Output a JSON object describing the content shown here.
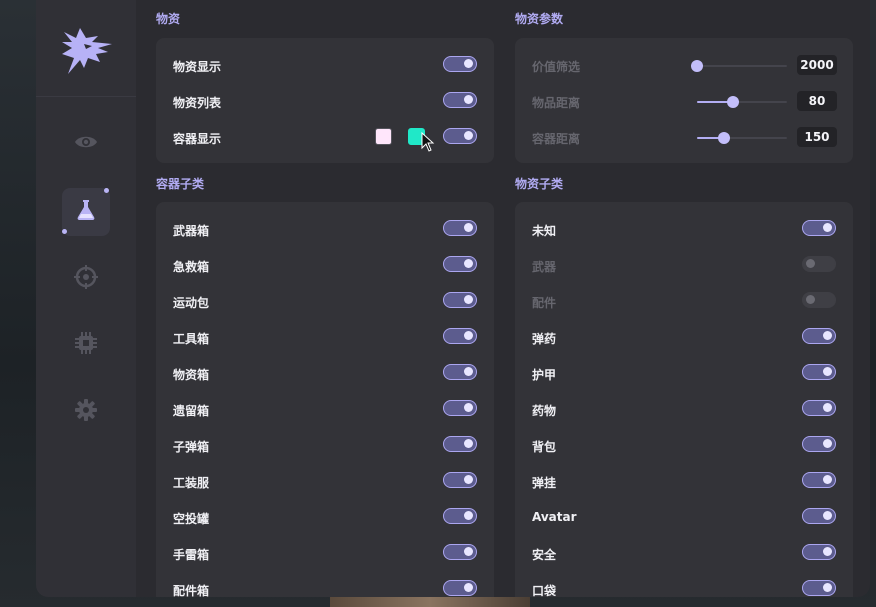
{
  "sections": {
    "items": {
      "title": "物资"
    },
    "item_params": {
      "title": "物资参数"
    },
    "container_types": {
      "title": "容器子类"
    },
    "item_types": {
      "title": "物资子类"
    }
  },
  "items_panel": {
    "rows": [
      {
        "label": "物资显示",
        "enabled": true
      },
      {
        "label": "物资列表",
        "enabled": true
      },
      {
        "label": "容器显示",
        "enabled": true
      }
    ],
    "container_colors": [
      "#ffe6fb",
      "#20e8c8"
    ]
  },
  "params_panel": {
    "rows": [
      {
        "label": "价值筛选",
        "value": "2000",
        "level": 0.0
      },
      {
        "label": "物品距离",
        "value": "80",
        "level": 0.4
      },
      {
        "label": "容器距离",
        "value": "150",
        "level": 0.3
      }
    ]
  },
  "container_types": [
    {
      "label": "武器箱",
      "enabled": true
    },
    {
      "label": "急救箱",
      "enabled": true
    },
    {
      "label": "运动包",
      "enabled": true
    },
    {
      "label": "工具箱",
      "enabled": true
    },
    {
      "label": "物资箱",
      "enabled": true
    },
    {
      "label": "遗留箱",
      "enabled": true
    },
    {
      "label": "子弹箱",
      "enabled": true
    },
    {
      "label": "工装服",
      "enabled": true
    },
    {
      "label": "空投罐",
      "enabled": true
    },
    {
      "label": "手雷箱",
      "enabled": true
    },
    {
      "label": "配件箱",
      "enabled": true
    }
  ],
  "item_types": [
    {
      "label": "未知",
      "enabled": true
    },
    {
      "label": "武器",
      "enabled": false
    },
    {
      "label": "配件",
      "enabled": false
    },
    {
      "label": "弹药",
      "enabled": true
    },
    {
      "label": "护甲",
      "enabled": true
    },
    {
      "label": "药物",
      "enabled": true
    },
    {
      "label": "背包",
      "enabled": true
    },
    {
      "label": "弹挂",
      "enabled": true
    },
    {
      "label": "Avatar",
      "enabled": true
    },
    {
      "label": "安全",
      "enabled": true
    },
    {
      "label": "口袋",
      "enabled": true
    }
  ],
  "sidebar": {
    "items": [
      {
        "icon": "eye-icon",
        "active": false
      },
      {
        "icon": "flask-icon",
        "active": true
      },
      {
        "icon": "crosshair-icon",
        "active": false
      },
      {
        "icon": "chip-icon",
        "active": false
      },
      {
        "icon": "gear-icon",
        "active": false
      }
    ]
  },
  "colors": {
    "accent": "#b1abf2",
    "panel": "#333338",
    "background": "#2b2b30"
  }
}
